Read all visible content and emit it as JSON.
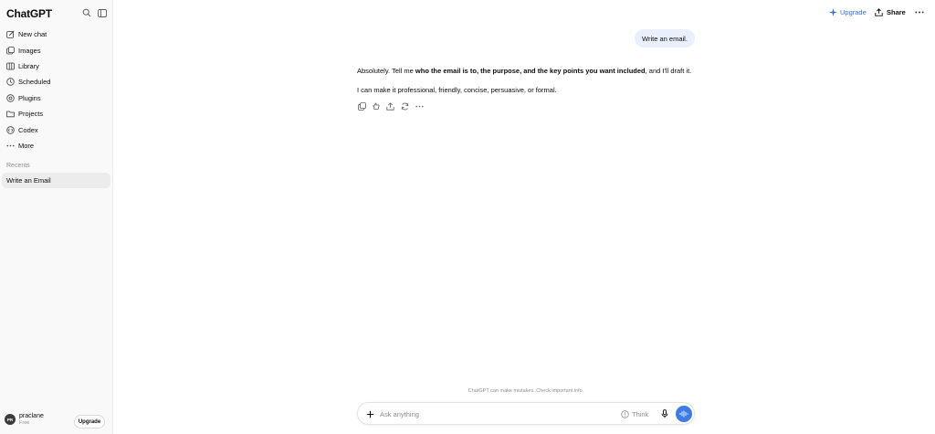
{
  "sidebar": {
    "brand": "ChatGPT",
    "nav": [
      {
        "label": "New chat",
        "icon": "edit-icon"
      },
      {
        "label": "Images",
        "icon": "images-icon"
      },
      {
        "label": "Library",
        "icon": "library-icon"
      },
      {
        "label": "Scheduled",
        "icon": "clock-icon"
      },
      {
        "label": "Plugins",
        "icon": "plugins-icon"
      },
      {
        "label": "Projects",
        "icon": "folder-icon"
      },
      {
        "label": "Codex",
        "icon": "codex-icon"
      },
      {
        "label": "More",
        "icon": "more-dots-icon"
      }
    ],
    "recents_label": "Recents",
    "recents": [
      "Write an Email"
    ],
    "user": {
      "initials": "PR",
      "name": "praclane",
      "plan": "Free",
      "upgrade_label": "Upgrade"
    }
  },
  "header": {
    "upgrade_label": "Upgrade",
    "share_label": "Share"
  },
  "conversation": {
    "user_message": "Write an email.",
    "assistant": {
      "p1_before": "Absolutely. Tell me ",
      "p1_bold": "who the email is to, the purpose, and the key points you want included",
      "p1_after": ", and I'll draft it.",
      "p2": "I can make it professional, friendly, concise, persuasive, or formal."
    }
  },
  "composer": {
    "placeholder": "Ask anything",
    "think_label": "Think",
    "disclaimer": "ChatGPT can make mistakes. Check important info."
  },
  "colors": {
    "accent": "#2f6fe0",
    "voice_button": "#3d7be6",
    "user_bubble": "#e9effb",
    "sidebar_bg": "#f9f9f9"
  }
}
